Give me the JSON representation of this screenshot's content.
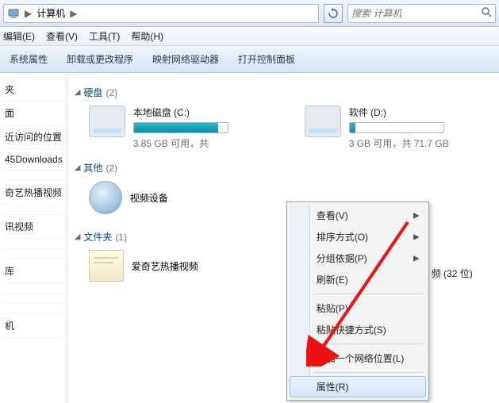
{
  "address": {
    "location": "计算机",
    "sep": "▶"
  },
  "search": {
    "placeholder": "搜索 计算机"
  },
  "menu": {
    "edit": "编辑(E)",
    "view": "查看(V)",
    "tools": "工具(T)",
    "help": "帮助(H)"
  },
  "cmd": {
    "sys": "系统属性",
    "uninstall": "卸载或更改程序",
    "netdrive": "映射网络驱动器",
    "cpanel": "打开控制面板"
  },
  "sidebar": {
    "items": [
      "夹",
      "面",
      "近访问的位置",
      "45Downloads",
      "",
      "奇艺热播视频",
      "",
      "讯视频",
      "",
      "",
      "库",
      "",
      "",
      "",
      "机"
    ]
  },
  "groups": {
    "drives": {
      "label": "硬盘",
      "count": "(2)"
    },
    "other": {
      "label": "其他",
      "count": "(2)"
    },
    "folders": {
      "label": "文件夹",
      "count": "(1)"
    }
  },
  "drives": {
    "c": {
      "name": "本地磁盘 (C:)",
      "free": "3.85 GB 可用，共",
      "fill_pct": 90
    },
    "d": {
      "name": "软件 (D:)",
      "free": "3 GB 可用，共 71.7 GB",
      "fill_pct": 6
    }
  },
  "other_item": {
    "name": "视频设备"
  },
  "extra": {
    "text": "频 (32 位)"
  },
  "folder_item": {
    "name": "爱奇艺热播视频"
  },
  "ctx": {
    "view": "查看(V)",
    "sort": "排序方式(O)",
    "group": "分组依据(P)",
    "refresh": "刷新(E)",
    "paste": "粘贴(P)",
    "paste_shortcut": "粘贴快捷方式(S)",
    "add_netloc": "添加一个网络位置(L)",
    "properties": "属性(R)"
  }
}
